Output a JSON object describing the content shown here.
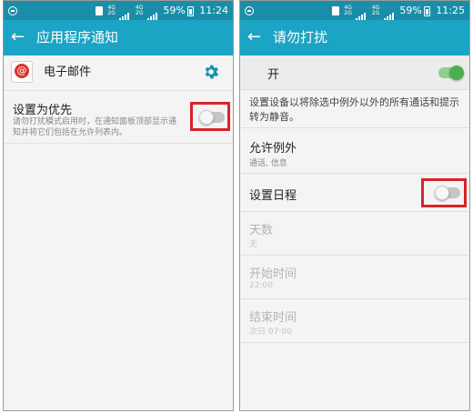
{
  "left": {
    "status": {
      "net_small_top": "4G",
      "net_small_bot": "2G",
      "battery": "59%",
      "time": "11:24"
    },
    "appbar": {
      "title": "应用程序通知"
    },
    "app": {
      "name": "电子邮件"
    },
    "priority": {
      "title": "设置为优先",
      "desc": "请勿打扰模式启用时，在通知面板顶部显示通知并将它们包括在允许列表内。",
      "enabled": false
    }
  },
  "right": {
    "status": {
      "net_small_top": "4G",
      "net_small_bot": "2G",
      "battery": "59%",
      "time": "11:25"
    },
    "appbar": {
      "title": "请勿打扰"
    },
    "main_toggle": {
      "label": "开",
      "enabled": true
    },
    "description": "设置设备以将除选中例外以外的所有通话和提示转为静音。",
    "exceptions": {
      "title": "允许例外",
      "sub": "通话, 信息"
    },
    "schedule": {
      "title": "设置日程",
      "enabled": false
    },
    "days": {
      "title": "天数",
      "sub": "无"
    },
    "start_time": {
      "title": "开始时间",
      "sub": "22:00"
    },
    "end_time": {
      "title": "结束时间",
      "sub": "次日 07:00"
    }
  },
  "colors": {
    "statusbar": "#1a8ea8",
    "appbar": "#1ca4c4",
    "highlight": "#d8232a",
    "toggle_on": "#4caf50"
  }
}
